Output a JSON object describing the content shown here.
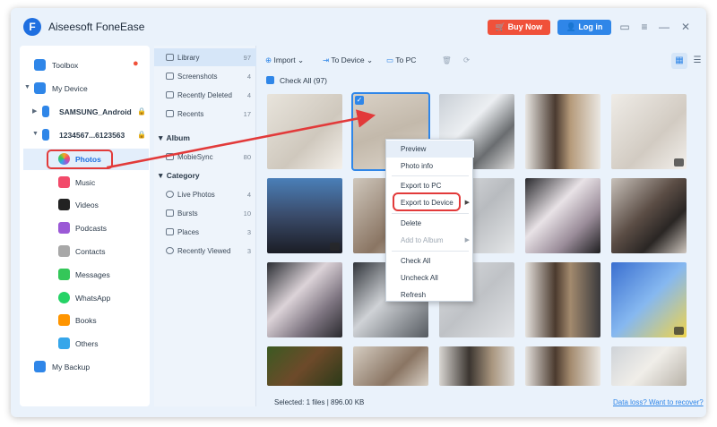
{
  "app": {
    "title": "Aiseesoft FoneEase",
    "logo_letter": "F",
    "buy_label": "Buy Now",
    "login_label": "Log in"
  },
  "sidebar": {
    "toolbox": "Toolbox",
    "my_device": "My Device",
    "device1": "SAMSUNG_Android",
    "device2": "1234567...6123563",
    "items": [
      {
        "label": "Photos",
        "color": "#f5a623"
      },
      {
        "label": "Music",
        "color": "#f24a6a"
      },
      {
        "label": "Videos",
        "color": "#222222"
      },
      {
        "label": "Podcasts",
        "color": "#9b59d6"
      },
      {
        "label": "Contacts",
        "color": "#a8a8a8"
      },
      {
        "label": "Messages",
        "color": "#34c759"
      },
      {
        "label": "WhatsApp",
        "color": "#25d366"
      },
      {
        "label": "Books",
        "color": "#ff9500"
      },
      {
        "label": "Others",
        "color": "#36a6ea"
      }
    ],
    "my_backup": "My Backup"
  },
  "categories": {
    "library": {
      "label": "Library",
      "count": "97"
    },
    "screenshots": {
      "label": "Screenshots",
      "count": "4"
    },
    "recently_deleted": {
      "label": "Recently Deleted",
      "count": "4"
    },
    "recents": {
      "label": "Recents",
      "count": "17"
    },
    "album_head": "Album",
    "mobiesync": {
      "label": "MobieSync",
      "count": "80"
    },
    "category_head": "Category",
    "live_photos": {
      "label": "Live Photos",
      "count": "4"
    },
    "bursts": {
      "label": "Bursts",
      "count": "10"
    },
    "places": {
      "label": "Places",
      "count": "3"
    },
    "recently_viewed": {
      "label": "Recently Viewed",
      "count": "3"
    }
  },
  "toolbar": {
    "import": "Import",
    "to_device": "To Device",
    "to_pc": "To PC"
  },
  "check_all": "Check All (97)",
  "context_menu": {
    "preview": "Preview",
    "photo_info": "Photo info",
    "export_pc": "Export to PC",
    "export_device": "Export to Device",
    "delete": "Delete",
    "add_album": "Add to Album",
    "check_all": "Check All",
    "uncheck_all": "Uncheck All",
    "refresh": "Refresh"
  },
  "status": {
    "selected": "Selected: 1 files | 896.00 KB",
    "recover": "Data loss? Want to recover?"
  },
  "colors": {
    "accent": "#2f86e8",
    "buy": "#f0513a",
    "highlight": "#e23a3a"
  }
}
